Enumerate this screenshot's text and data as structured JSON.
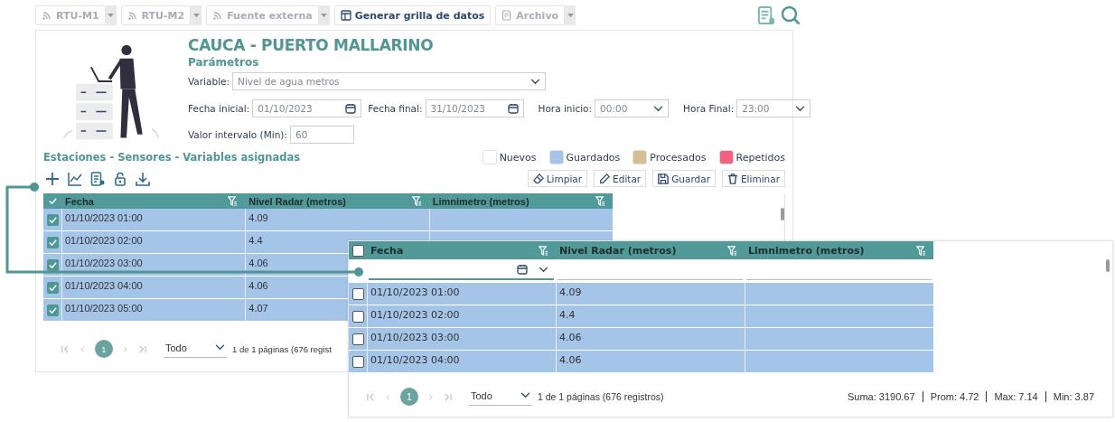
{
  "toolbar": {
    "buttons": [
      {
        "label": "RTU-M1",
        "kind": "signal",
        "split": true,
        "disabled": true
      },
      {
        "label": "RTU-M2",
        "kind": "signal",
        "split": true,
        "disabled": true
      },
      {
        "label": "Fuente externa",
        "kind": "signal",
        "split": true,
        "disabled": true
      },
      {
        "label": "Generar grilla de datos",
        "kind": "table",
        "split": false,
        "disabled": false
      },
      {
        "label": "Archivo",
        "kind": "document",
        "split": true,
        "disabled": true
      }
    ]
  },
  "station": {
    "title": "CAUCA - PUERTO MALLARINO",
    "subtitle": "Parámetros"
  },
  "form": {
    "variable": {
      "label": "Variable:",
      "value": "Nivel de agua metros"
    },
    "fecha_inicial": {
      "label": "Fecha inicial:",
      "value": "01/10/2023"
    },
    "fecha_final": {
      "label": "Fecha final:",
      "value": "31/10/2023"
    },
    "hora_inicio": {
      "label": "Hora inicio:",
      "value": "00:00"
    },
    "hora_final": {
      "label": "Hora Final:",
      "value": "23:00"
    },
    "intervalo": {
      "label": "Valor intervalo (Min):",
      "value": "60"
    }
  },
  "section_title": "Estaciones - Sensores - Variables asignadas",
  "legend": [
    {
      "label": "Nuevos",
      "color": "#ffffff"
    },
    {
      "label": "Guardados",
      "color": "#a4c4e8"
    },
    {
      "label": "Procesados",
      "color": "#d5bd95"
    },
    {
      "label": "Repetidos",
      "color": "#f2617f"
    }
  ],
  "actions": [
    {
      "label": "Limpiar",
      "kind": "eraser"
    },
    {
      "label": "Editar",
      "kind": "pencil"
    },
    {
      "label": "Guardar",
      "kind": "save"
    },
    {
      "label": "Eliminar",
      "kind": "trash"
    }
  ],
  "grid": {
    "header_checked": true,
    "columns": [
      "Fecha",
      "Nivel Radar (metros)",
      "Limnimetro (metros)"
    ],
    "rows": [
      {
        "checked": true,
        "values": [
          "01/10/2023 01:00",
          "4.09"
        ]
      },
      {
        "checked": true,
        "values": [
          "01/10/2023 02:00",
          "4.4"
        ]
      },
      {
        "checked": true,
        "values": [
          "01/10/2023 03:00",
          "4.06"
        ]
      },
      {
        "checked": true,
        "values": [
          "01/10/2023 04:00",
          "4.06"
        ]
      },
      {
        "checked": true,
        "values": [
          "01/10/2023 05:00",
          "4.07"
        ]
      }
    ],
    "pager": {
      "page": "1",
      "page_size": "Todo",
      "info": "1 de 1 páginas (676 regist"
    }
  },
  "zoom_grid": {
    "header_checked": false,
    "columns": [
      "Fecha",
      "Nivel Radar (metros)",
      "Limnimetro (metros)"
    ],
    "rows": [
      {
        "checked": false,
        "values": [
          "01/10/2023 01:00",
          "4.09"
        ]
      },
      {
        "checked": false,
        "values": [
          "01/10/2023 02:00",
          "4.4"
        ]
      },
      {
        "checked": false,
        "values": [
          "01/10/2023 03:00",
          "4.06"
        ]
      },
      {
        "checked": false,
        "values": [
          "01/10/2023 04:00",
          "4.06"
        ]
      }
    ],
    "pager": {
      "page": "1",
      "page_size": "Todo",
      "info": "1 de 1 páginas (676 registros)"
    },
    "summary": [
      "Suma: 3190.67",
      "Prom: 4.72",
      "Max: 7.14",
      "Min: 3.87"
    ]
  }
}
